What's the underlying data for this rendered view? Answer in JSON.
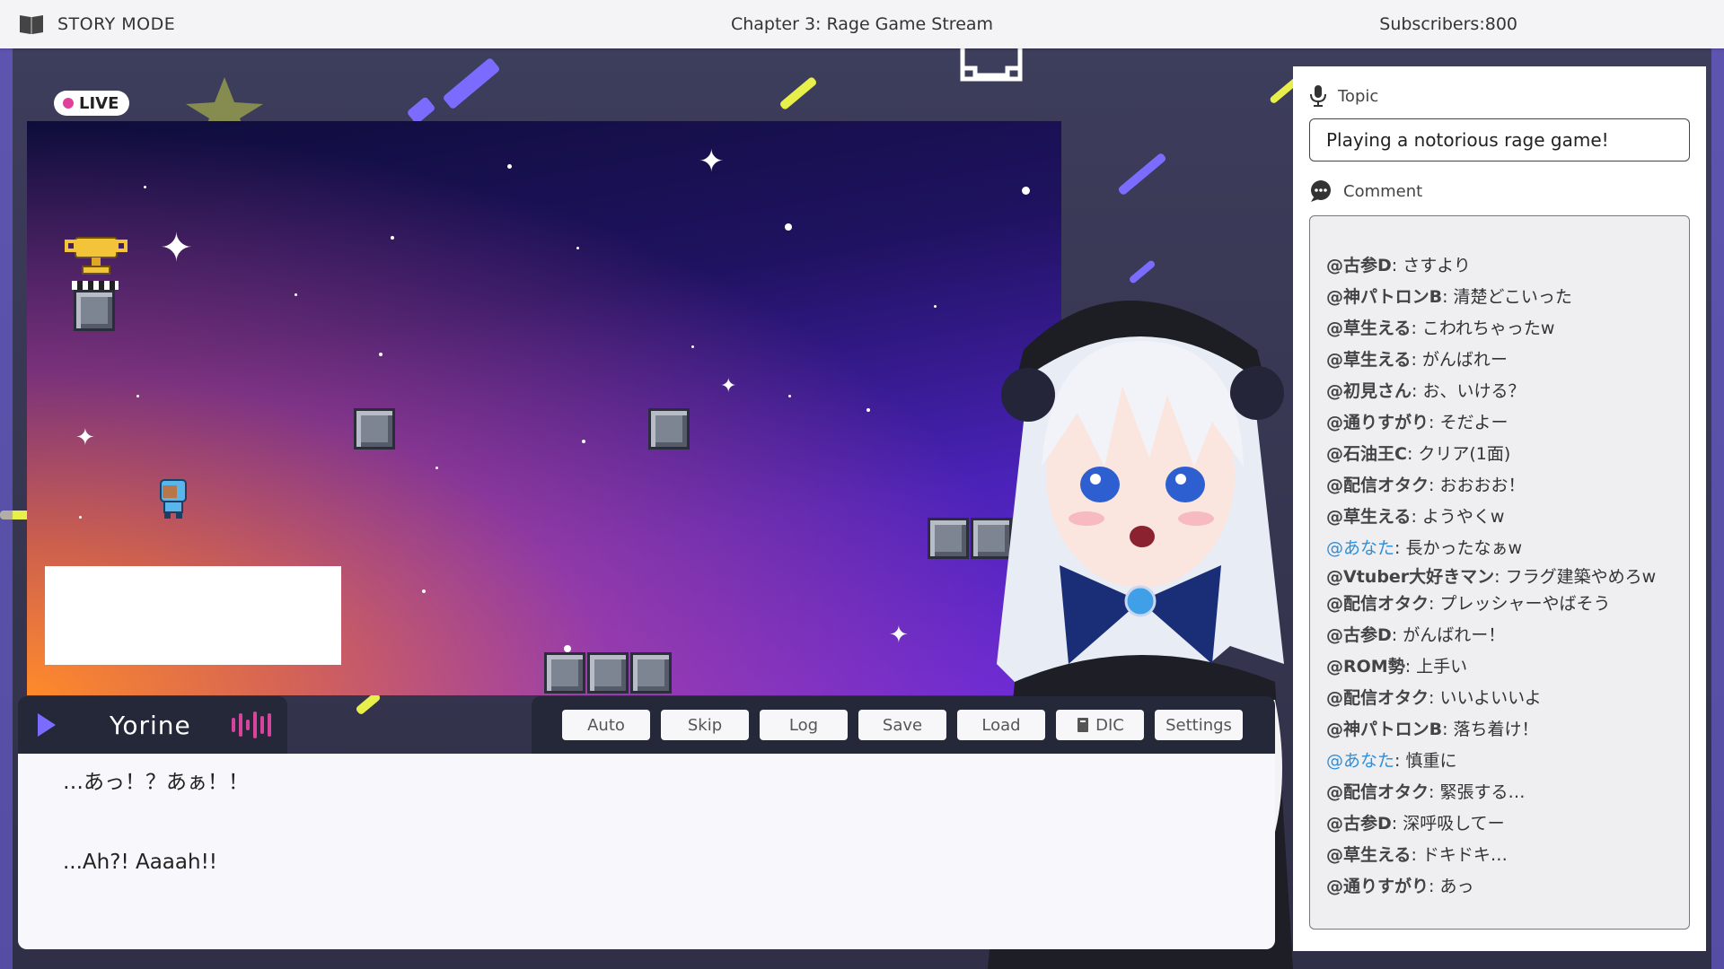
{
  "header": {
    "mode_label": "STORY MODE",
    "chapter_title": "Chapter 3: Rage Game Stream",
    "subscribers": "Subscribers:800"
  },
  "stream": {
    "live_label": "LIVE"
  },
  "dialogue": {
    "speaker": "Yorine",
    "line_jp": "…あっ！？あぁ！！",
    "line_en": "...Ah?! Aaaah!!"
  },
  "controls": {
    "auto": "Auto",
    "skip": "Skip",
    "log": "Log",
    "save": "Save",
    "load": "Load",
    "dic": "DIC",
    "settings": "Settings"
  },
  "panel": {
    "topic_label": "Topic",
    "topic_value": "Playing a notorious rage game!",
    "comment_label": "Comment",
    "comments": [
      {
        "user": "@古参D",
        "text": ": さすより"
      },
      {
        "user": "@神パトロンB",
        "text": ": 清楚どこいった"
      },
      {
        "user": "@草生える",
        "text": ": こわれちゃったw"
      },
      {
        "user": "@草生える",
        "text": ": がんばれー"
      },
      {
        "user": "@初見さん",
        "text": ": お、いける？"
      },
      {
        "user": "@通りすがり",
        "text": ": そだよー"
      },
      {
        "user": "@石油王C",
        "text": ": クリア(1面)"
      },
      {
        "user": "@配信オタク",
        "text": ": おおおお！"
      },
      {
        "user": "@草生える",
        "text": ": ようやくw"
      },
      {
        "user": "@あなた",
        "text": ": 長かったなぁw",
        "self": true
      },
      {
        "user": "@Vtuber大好きマン",
        "text": ": フラグ建築やめろw"
      },
      {
        "user": "@配信オタク",
        "text": ": プレッシャーやばそう"
      },
      {
        "user": "@古参D",
        "text": ": がんばれー！"
      },
      {
        "user": "@ROM勢",
        "text": ": 上手い"
      },
      {
        "user": "@配信オタク",
        "text": ": いいよいいよ"
      },
      {
        "user": "@神パトロンB",
        "text": ": 落ち着け！"
      },
      {
        "user": "@あなた",
        "text": ": 慎重に",
        "self": true
      },
      {
        "user": "@配信オタク",
        "text": ": 緊張する…"
      },
      {
        "user": "@古参D",
        "text": ": 深呼吸してー"
      },
      {
        "user": "@草生える",
        "text": ": ドキドキ…"
      },
      {
        "user": "@通りすがり",
        "text": ": あっ"
      }
    ]
  },
  "icons": {
    "mode": "book-icon",
    "topic": "microphone-icon",
    "comment": "speech-bubble-icon",
    "dic": "book-icon",
    "speaker": "play-triangle-icon",
    "voice": "sound-wave-icon"
  },
  "colors": {
    "accent": "#7b6cff",
    "live_dot": "#e0409a",
    "self_user": "#2f8fd8",
    "neon_yellow": "#e7f04a"
  }
}
